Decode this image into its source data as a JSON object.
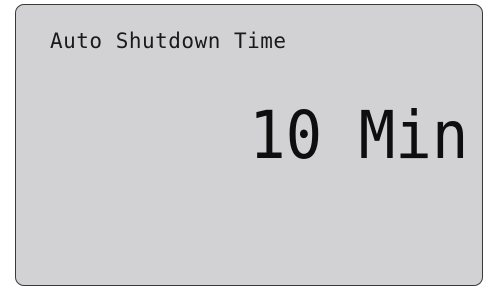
{
  "screen": {
    "title": "Auto Shutdown Time",
    "value": "10 Min"
  },
  "colors": {
    "lcd_background": "#d2d2d4",
    "text": "#1a1a1a",
    "bezel": "#3a3a3a"
  }
}
